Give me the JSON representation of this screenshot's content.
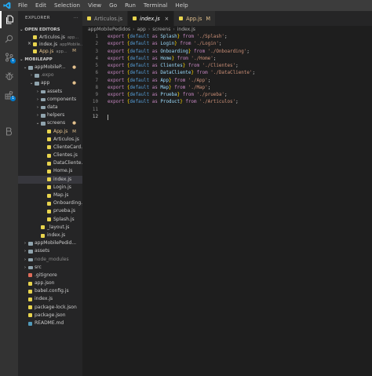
{
  "menu": [
    "File",
    "Edit",
    "Selection",
    "View",
    "Go",
    "Run",
    "Terminal",
    "Help"
  ],
  "activity_badges": {
    "source_control": "1",
    "extensions": "1"
  },
  "sidebar": {
    "title": "EXPLORER",
    "more": "···",
    "open_editors": {
      "header": "OPEN EDITORS",
      "items": [
        {
          "close": "",
          "name": "Articulos.js",
          "sub": "app...",
          "mark": "",
          "color": "#e8d44d"
        },
        {
          "close": "×",
          "name": "index.js",
          "sub": "appMobile...",
          "mark": "",
          "color": "#e8d44d"
        },
        {
          "close": "",
          "name": "App.js",
          "sub": "app...",
          "mark": "M",
          "color": "#e8d44d"
        }
      ]
    },
    "project": {
      "header": "MOBILEAPP",
      "rows": [
        {
          "depth": 0,
          "chev": "⌄",
          "name": "appMobileP...",
          "folder": true,
          "color": "#90a4ae",
          "mark": "●",
          "markColor": "#e2c08d"
        },
        {
          "depth": 1,
          "chev": "›",
          "name": ".expo",
          "folder": true,
          "color": "#90a4ae",
          "dim": true
        },
        {
          "depth": 1,
          "chev": "⌄",
          "name": "app",
          "folder": true,
          "color": "#90a4ae",
          "mark": "●",
          "markColor": "#e2c08d"
        },
        {
          "depth": 2,
          "chev": "›",
          "name": "assets",
          "folder": true,
          "color": "#90a4ae"
        },
        {
          "depth": 2,
          "chev": "›",
          "name": "components",
          "folder": true,
          "color": "#90a4ae"
        },
        {
          "depth": 2,
          "chev": "›",
          "name": "data",
          "folder": true,
          "color": "#90a4ae"
        },
        {
          "depth": 2,
          "chev": "›",
          "name": "helpers",
          "folder": true,
          "color": "#90a4ae"
        },
        {
          "depth": 2,
          "chev": "⌄",
          "name": "screens",
          "folder": true,
          "color": "#90a4ae",
          "mark": "●",
          "markColor": "#e2c08d"
        },
        {
          "depth": 3,
          "name": "App.js",
          "color": "#e8d44d",
          "mark": "M",
          "markColor": "#e2c08d",
          "labelColor": "#e2c08d"
        },
        {
          "depth": 3,
          "name": "Articulos.js",
          "color": "#e8d44d"
        },
        {
          "depth": 3,
          "name": "ClienteCard.js",
          "color": "#e8d44d"
        },
        {
          "depth": 3,
          "name": "Clientes.js",
          "color": "#e8d44d"
        },
        {
          "depth": 3,
          "name": "DataCliente.js",
          "color": "#e8d44d"
        },
        {
          "depth": 3,
          "name": "Home.js",
          "color": "#e8d44d"
        },
        {
          "depth": 3,
          "name": "index.js",
          "color": "#e8d44d",
          "selected": true
        },
        {
          "depth": 3,
          "name": "Login.js",
          "color": "#e8d44d"
        },
        {
          "depth": 3,
          "name": "Map.js",
          "color": "#e8d44d"
        },
        {
          "depth": 3,
          "name": "Onboarding.js",
          "color": "#e8d44d"
        },
        {
          "depth": 3,
          "name": "prueba.js",
          "color": "#e8d44d"
        },
        {
          "depth": 3,
          "name": "Splash.js",
          "color": "#e8d44d"
        },
        {
          "depth": 2,
          "name": "_layout.js",
          "color": "#e8d44d"
        },
        {
          "depth": 2,
          "name": "index.js",
          "color": "#e8d44d"
        },
        {
          "depth": 0,
          "chev": "›",
          "name": "appMobilePedid...",
          "folder": true,
          "color": "#90a4ae"
        },
        {
          "depth": 0,
          "chev": "›",
          "name": "assets",
          "folder": true,
          "color": "#90a4ae"
        },
        {
          "depth": 0,
          "chev": "›",
          "name": "node_modules",
          "folder": true,
          "color": "#90a4ae",
          "dim": true
        },
        {
          "depth": 0,
          "chev": "›",
          "name": "src",
          "folder": true,
          "color": "#90a4ae"
        },
        {
          "depth": 0,
          "name": ".gitignore",
          "color": "#e06c5a"
        },
        {
          "depth": 0,
          "name": "app.json",
          "color": "#e8d44d"
        },
        {
          "depth": 0,
          "name": "babel.config.js",
          "color": "#e8d44d"
        },
        {
          "depth": 0,
          "name": "index.js",
          "color": "#e8d44d"
        },
        {
          "depth": 0,
          "name": "package-lock.json",
          "color": "#e8d44d"
        },
        {
          "depth": 0,
          "name": "package.json",
          "color": "#e8d44d"
        },
        {
          "depth": 0,
          "name": "README.md",
          "color": "#519aba"
        }
      ]
    }
  },
  "tabs": [
    {
      "name": "Articulos.js",
      "active": false,
      "color": "#e8d44d"
    },
    {
      "name": "index.js",
      "active": true,
      "close": "×",
      "color": "#e8d44d"
    },
    {
      "name": "App.js",
      "active": false,
      "mark": "M",
      "color": "#e8d44d"
    }
  ],
  "breadcrumb": [
    "appMobilePedidos",
    "app",
    "screens",
    "index.js"
  ],
  "code": {
    "lines": [
      {
        "n": "1",
        "name": "Splash",
        "path": "'./Splash'"
      },
      {
        "n": "2",
        "name": "Login",
        "path": "'./Login'"
      },
      {
        "n": "3",
        "name": "Onboarding",
        "path": "'./Onboarding'"
      },
      {
        "n": "4",
        "name": "Home",
        "path": "'./Home'"
      },
      {
        "n": "5",
        "name": "Clientes",
        "path": "'./Clientes'"
      },
      {
        "n": "6",
        "name": "DataCliente",
        "path": "'./DataCliente'"
      },
      {
        "n": "7",
        "name": "App",
        "path": "'./App'"
      },
      {
        "n": "8",
        "name": "Map",
        "path": "'./Map'"
      },
      {
        "n": "9",
        "name": "Prueba",
        "path": "'./prueba'"
      },
      {
        "n": "10",
        "name": "Product",
        "path": "'./Articulos'"
      },
      {
        "n": "11",
        "name": "",
        "path": ""
      },
      {
        "n": "12",
        "name": "",
        "path": "",
        "current": true
      }
    ],
    "tokens": {
      "export": "export",
      "default": "default",
      "as": "as",
      "from": "from",
      "open": "{",
      "close": "}",
      "semi": ";"
    }
  }
}
